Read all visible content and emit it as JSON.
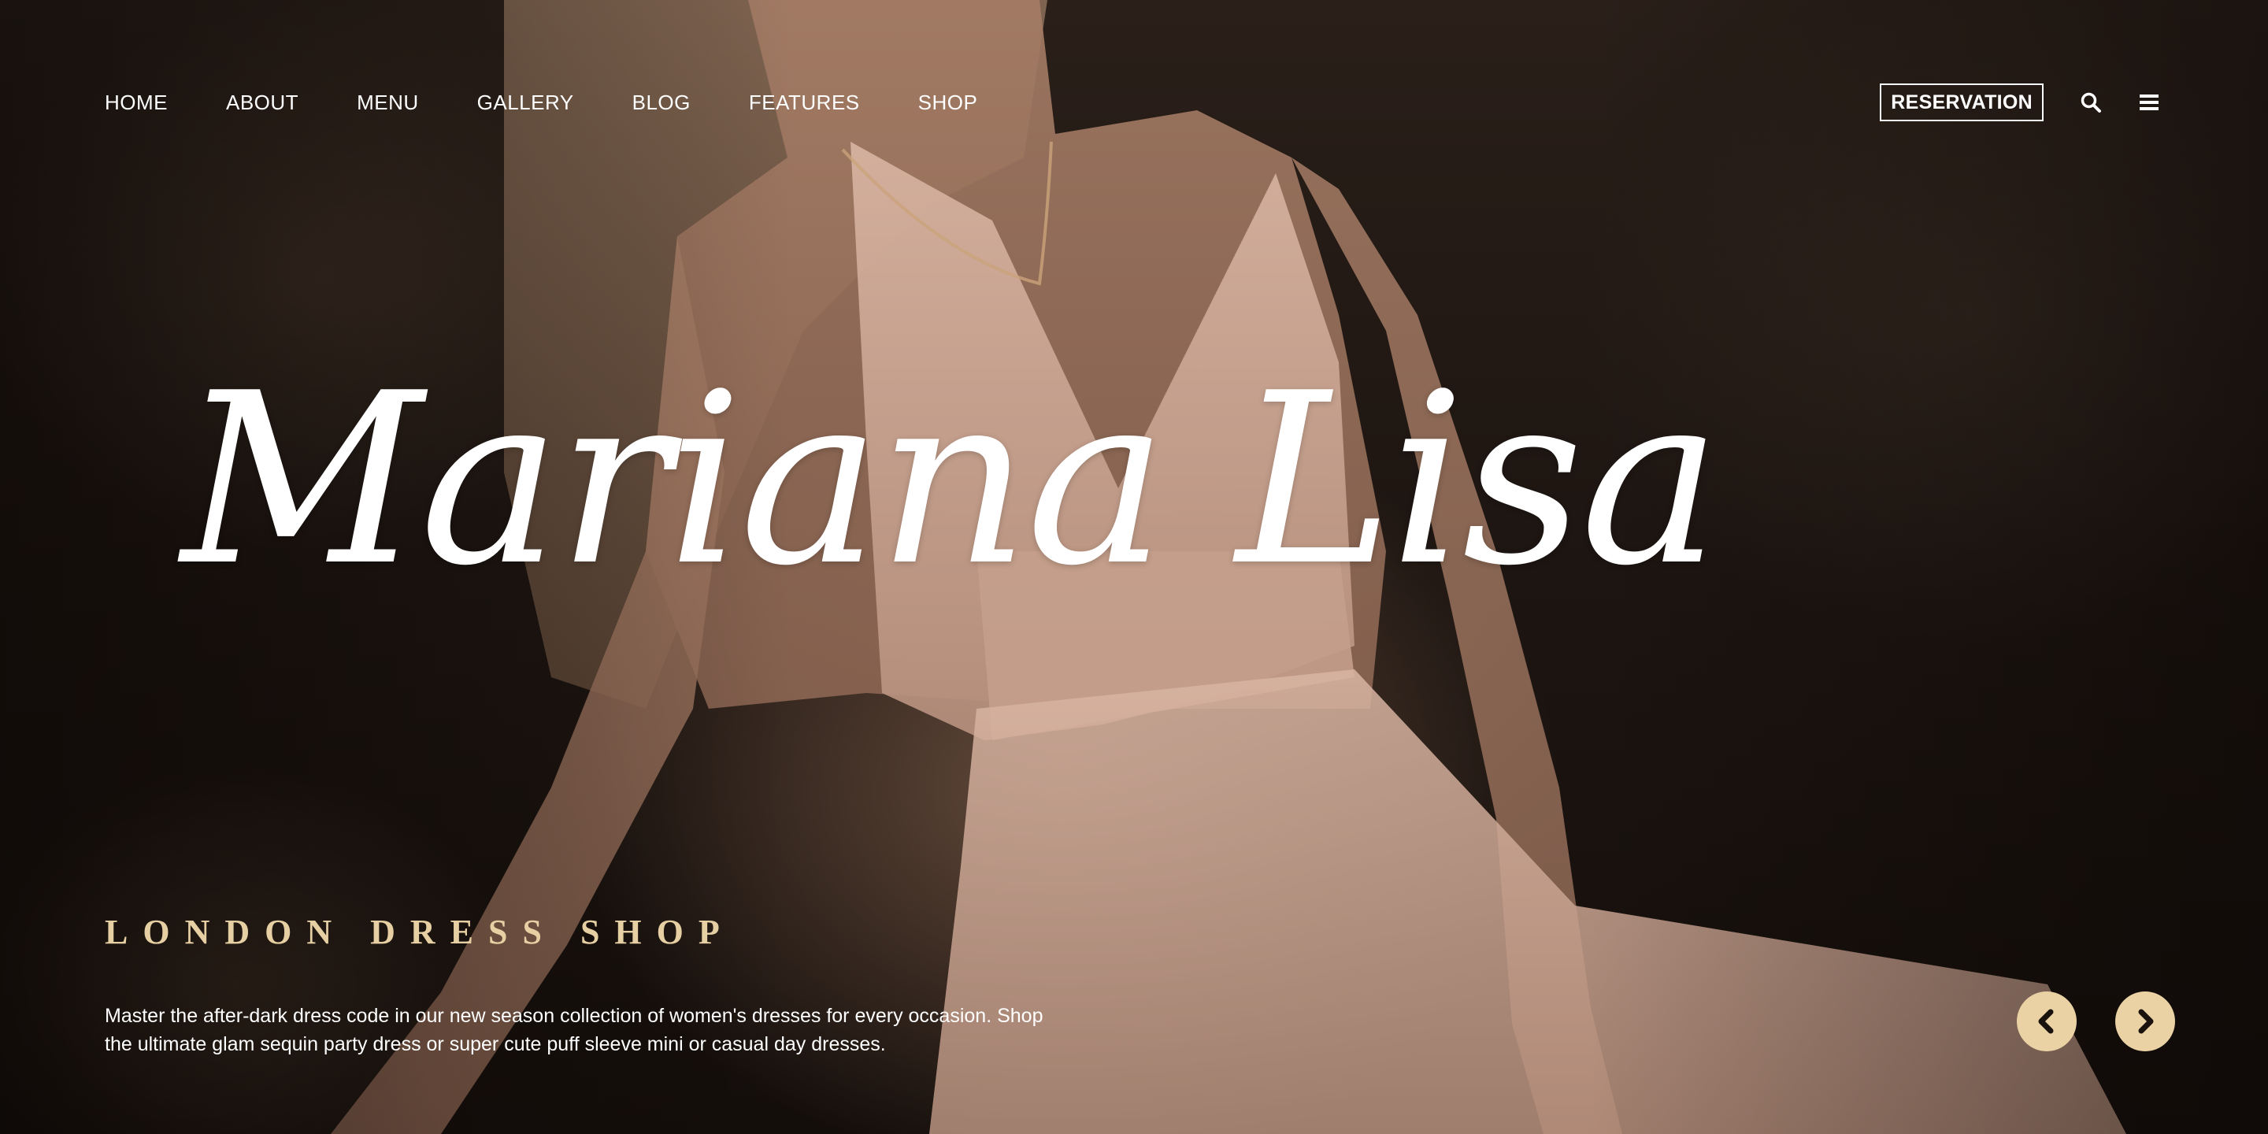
{
  "nav": {
    "items": [
      {
        "label": "HOME"
      },
      {
        "label": "ABOUT"
      },
      {
        "label": "MENU"
      },
      {
        "label": "GALLERY"
      },
      {
        "label": "BLOG"
      },
      {
        "label": "FEATURES"
      },
      {
        "label": "SHOP"
      }
    ],
    "reservation_label": "RESERVATION",
    "icons": [
      "search-icon",
      "hamburger-menu-icon"
    ]
  },
  "hero": {
    "script_title": "Mariana Lisa",
    "eyebrow": "LONDON DRESS SHOP",
    "description": "Master the after-dark dress code in our new season collection of women's dresses for every occasion. Shop the ultimate glam sequin party dress or super cute puff sleeve mini or casual day dresses."
  },
  "slider": {
    "prev_icon": "chevron-left-icon",
    "next_icon": "chevron-right-icon"
  },
  "colors": {
    "accent": "#ead2a4",
    "eyebrow": "#e6cfa3",
    "background": "#140e0b",
    "text": "#ffffff"
  }
}
